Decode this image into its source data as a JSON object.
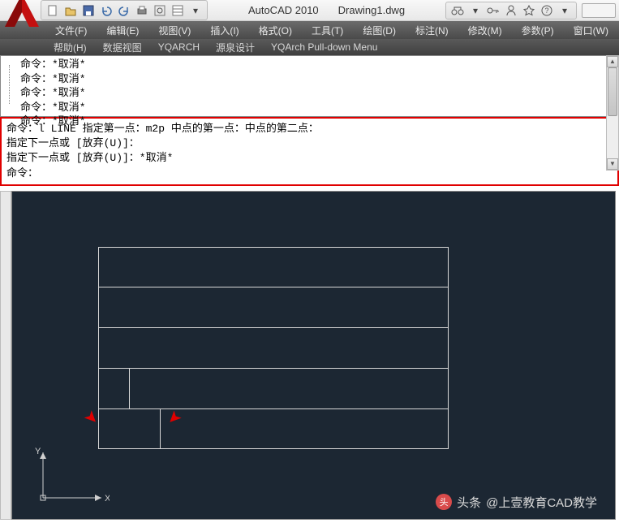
{
  "titlebar": {
    "app": "AutoCAD 2010",
    "doc": "Drawing1.dwg"
  },
  "menu": {
    "file": "文件(F)",
    "edit": "编辑(E)",
    "view": "视图(V)",
    "insert": "插入(I)",
    "format": "格式(O)",
    "tools": "工具(T)",
    "draw": "绘图(D)",
    "dimension": "标注(N)",
    "modify": "修改(M)",
    "parameters": "参数(P)",
    "window": "窗口(W)"
  },
  "menu2": {
    "help": "帮助(H)",
    "dataview": "数据视图",
    "yqarch": "YQARCH",
    "yuanquan": "源泉设计",
    "pulldown": "YQArch Pull-down Menu"
  },
  "cmd": {
    "l1": "命令：*取消*",
    "l2": "命令：*取消*",
    "l3": "命令：*取消*",
    "l4": "命令：*取消*",
    "l5": "命令：*取消*",
    "r1": "命令：l LINE 指定第一点：m2p 中点的第一点：中点的第二点：",
    "r2": "指定下一点或 [放弃(U)]：",
    "r3": "指定下一点或 [放弃(U)]：*取消*",
    "r4": "命令："
  },
  "ucs": {
    "x": "X",
    "y": "Y"
  },
  "watermark": {
    "logo": "头",
    "prefix": "头条",
    "text": "@上壹教育CAD教学"
  }
}
